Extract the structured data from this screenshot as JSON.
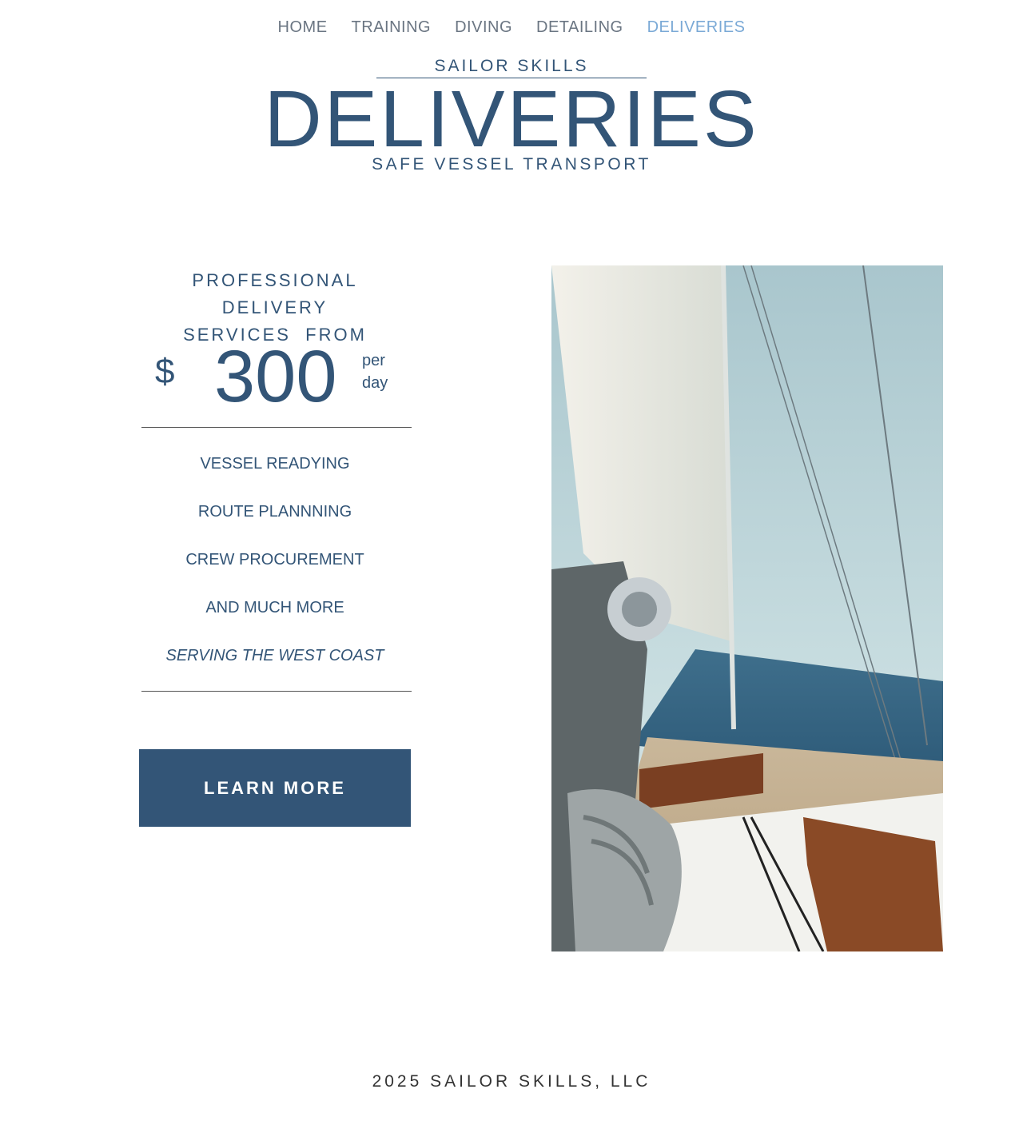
{
  "nav": {
    "items": [
      {
        "label": "HOME"
      },
      {
        "label": "TRAINING"
      },
      {
        "label": "DIVING"
      },
      {
        "label": "DETAILING"
      },
      {
        "label": "DELIVERIES",
        "active": true
      }
    ]
  },
  "header": {
    "brand": "SAILOR SKILLS",
    "title": "DELIVERIES",
    "subtitle": "SAFE VESSEL TRANSPORT"
  },
  "pricing": {
    "intro_line1": "PROFESSIONAL DELIVERY",
    "intro_line2": "SERVICES  FROM",
    "currency": "$",
    "amount": "300",
    "unit_line1": "per",
    "unit_line2": "day"
  },
  "features": [
    "VESSEL READYING",
    "ROUTE PLANNNING",
    "CREW PROCUREMENT",
    "AND MUCH MORE",
    "SERVING THE WEST COAST"
  ],
  "cta": {
    "label": "LEARN MORE"
  },
  "footer": {
    "text": "2025 SAILOR SKILLS, LLC"
  },
  "colors": {
    "primary": "#335577",
    "nav_text": "#6a7582",
    "nav_active": "#7aa9d6",
    "button_bg": "#335577",
    "button_text": "#ffffff"
  },
  "photo": {
    "icon": "sailboat-photo"
  }
}
